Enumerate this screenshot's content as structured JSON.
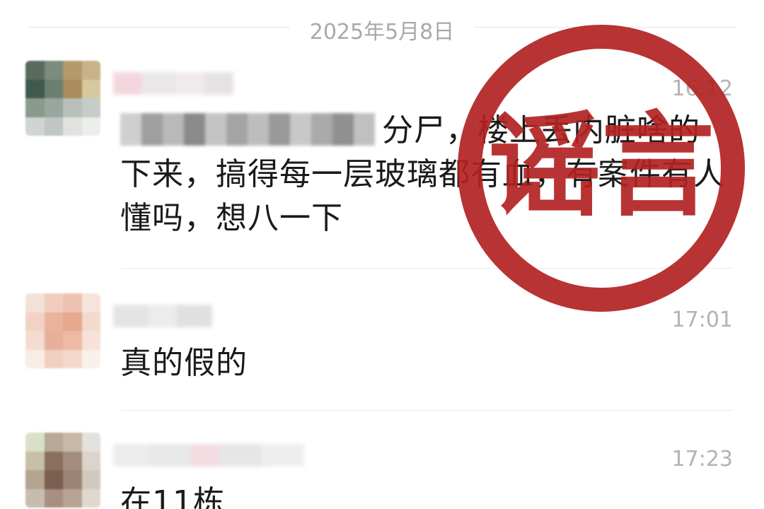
{
  "conversation": {
    "date": "2025年5月8日",
    "messages": [
      {
        "sender_blurred": true,
        "time": "16:12",
        "line1_visible": "分尸，楼上丢内脏啥的",
        "line2": "下来，搞得每一层玻璃都有血，有案件有人",
        "line3": "懂吗，想八一下"
      },
      {
        "sender_blurred": true,
        "time": "17:01",
        "text": "真的假的"
      },
      {
        "sender_blurred": true,
        "time": "17:23",
        "text": "在11栋"
      }
    ]
  },
  "stamp": {
    "text": "谣言",
    "color": "#b22222"
  }
}
